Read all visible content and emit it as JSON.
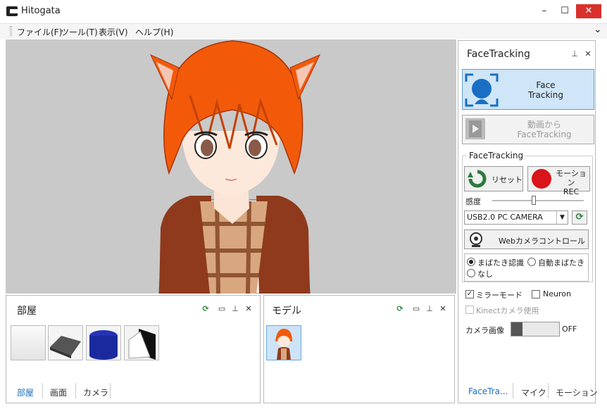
{
  "window": {
    "title": "Hitogata",
    "minimize": "–",
    "maximize": "☐",
    "close": "✕"
  },
  "menu": {
    "items": [
      "ファイル(F)",
      "ツール(T)",
      "表示(V)",
      "ヘルプ(H)"
    ],
    "overflow": "⌄"
  },
  "room_panel": {
    "title": "部屋",
    "tabs": [
      "部屋",
      "画面",
      "カメラ"
    ],
    "active_tab": 0
  },
  "model_panel": {
    "title": "モデル"
  },
  "panel_buttons": {
    "refresh": "⟳",
    "restore": "▭",
    "pin": "⊥",
    "close": "✕"
  },
  "face_panel": {
    "title": "FaceTracking",
    "face_tracking_button": "Face\nTracking",
    "video_button": "動画から\nFaceTracking",
    "group_title": "FaceTracking",
    "reset_label": "リセット",
    "motion_rec_label": "モーション\nREC",
    "sensitivity_label": "感度",
    "sensitivity_value": 0.45,
    "camera_select": "USB2.0 PC CAMERA",
    "webcam_control_label": "Webカメラコントロール",
    "blink_options": [
      "まばたき認識",
      "自動まばたき",
      "なし"
    ],
    "blink_selected": 0,
    "mirror_mode": {
      "label": "ミラーモード",
      "checked": true
    },
    "neuron": {
      "label": "Neuron",
      "checked": false
    },
    "kinect": {
      "label": "Kinectカメラ使用",
      "checked": false
    },
    "camera_image_label": "カメラ画像",
    "camera_image_toggle": "OFF",
    "tabs": [
      "FaceTra...",
      "マイク",
      "モーション"
    ],
    "active_tab": 0
  },
  "colors": {
    "accent": "#1a6fc4",
    "record": "#d9141b",
    "close": "#d9312b"
  }
}
